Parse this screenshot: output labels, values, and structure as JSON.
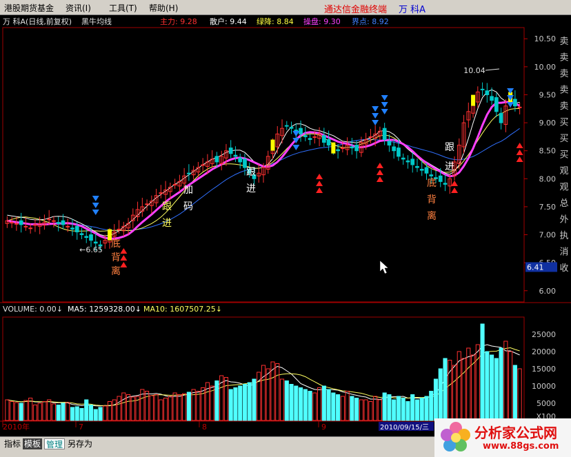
{
  "menu": {
    "items": [
      "港股期货基金",
      "资讯(I)",
      "工具(T)",
      "帮助(H)"
    ],
    "app_title": "通达信金融终端",
    "stock_title": "万  科A"
  },
  "indicator_header": {
    "stock": "万  科A(日线,前复权)",
    "formula": "黑牛均线",
    "items": [
      {
        "label": "主力: 9.28",
        "color": "#ff3030"
      },
      {
        "label": "散户: 9.44",
        "color": "#ffffff"
      },
      {
        "label": "绿降: 8.84",
        "color": "#ffff40"
      },
      {
        "label": "操盘: 9.30",
        "color": "#ff40ff"
      },
      {
        "label": "界点: 8.92",
        "color": "#4080ff"
      }
    ]
  },
  "price_axis": {
    "labels": [
      "10.50",
      "10.00",
      "9.50",
      "9.00",
      "8.50",
      "8.00",
      "7.50",
      "7.00",
      "6.50",
      "6.00"
    ],
    "current_label": "6.41"
  },
  "volume_header": {
    "vol": "VOLUME: 0.00",
    "ma5": "MA5: 1259328.00",
    "ma10": "MA10: 1607507.25"
  },
  "volume_axis": {
    "labels": [
      "25000",
      "20000",
      "15000",
      "10000",
      "5000",
      "X100"
    ]
  },
  "date_axis": {
    "labels": [
      "2010年",
      "7",
      "8",
      "9"
    ],
    "cursor_date": "2010/09/15/三"
  },
  "side_signals": [
    "卖",
    "卖",
    "卖",
    "卖",
    "卖",
    "买",
    "买",
    "买",
    "观",
    "观",
    "总",
    "外",
    "执",
    "消",
    "收"
  ],
  "annotations": {
    "high_label": "10.04",
    "low_label": "6.65",
    "texts": [
      {
        "text": "底",
        "color": "#ff8040"
      },
      {
        "text": "背",
        "color": "#ff8040"
      },
      {
        "text": "离",
        "color": "#ff8040"
      },
      {
        "text": "跟",
        "color": "#ffff60"
      },
      {
        "text": "进",
        "color": "#ffff60"
      },
      {
        "text": "加",
        "color": "#ffffff"
      },
      {
        "text": "码",
        "color": "#ffffff"
      },
      {
        "text": "跟",
        "color": "#ffffff"
      },
      {
        "text": "进",
        "color": "#ffffff"
      },
      {
        "text": "底",
        "color": "#ff8040"
      },
      {
        "text": "背",
        "color": "#ff8040"
      },
      {
        "text": "离",
        "color": "#ff8040"
      },
      {
        "text": "跟",
        "color": "#ffffff"
      },
      {
        "text": "进",
        "color": "#ffffff"
      }
    ]
  },
  "tabs": [
    "指标",
    "模板",
    "管理",
    "另存为"
  ],
  "watermark": {
    "title": "分析家公式网",
    "url": "www.88gs.com"
  },
  "chart_data": {
    "type": "candlestick",
    "ylim": [
      5.8,
      10.7
    ],
    "close": [
      7.25,
      7.22,
      7.2,
      7.18,
      7.15,
      7.12,
      7.18,
      7.2,
      7.22,
      7.28,
      7.25,
      7.2,
      7.18,
      7.15,
      7.1,
      7.05,
      7.0,
      6.95,
      6.9,
      6.85,
      6.8,
      6.9,
      7.0,
      7.05,
      7.1,
      7.15,
      7.2,
      7.35,
      7.45,
      7.5,
      7.55,
      7.6,
      7.7,
      7.75,
      7.8,
      7.85,
      7.9,
      7.95,
      8.05,
      8.1,
      8.15,
      8.2,
      8.25,
      8.3,
      8.35,
      8.3,
      8.4,
      8.5,
      8.45,
      8.4,
      8.3,
      8.2,
      8.1,
      8.0,
      8.1,
      8.2,
      8.4,
      8.6,
      8.8,
      8.9,
      8.95,
      8.9,
      8.85,
      8.8,
      8.75,
      8.7,
      8.75,
      8.8,
      8.65,
      8.6,
      8.55,
      8.5,
      8.55,
      8.6,
      8.55,
      8.5,
      8.65,
      8.7,
      8.75,
      8.8,
      8.85,
      8.7,
      8.6,
      8.5,
      8.4,
      8.35,
      8.3,
      8.25,
      8.2,
      8.15,
      8.1,
      8.05,
      8.0,
      7.95,
      7.9,
      8.0,
      8.3,
      8.6,
      9.0,
      9.2,
      9.4,
      9.55,
      9.6,
      9.5,
      9.4,
      9.2,
      9.0,
      9.3,
      9.45,
      9.3,
      9.28
    ],
    "volume": [
      6000,
      5500,
      5200,
      5000,
      5800,
      6500,
      4500,
      5000,
      5500,
      6000,
      4800,
      4500,
      5000,
      5200,
      3800,
      4000,
      3500,
      6000,
      4500,
      3200,
      3800,
      4200,
      5500,
      6000,
      7000,
      8000,
      7500,
      6800,
      7000,
      9000,
      8500,
      7200,
      7500,
      6000,
      6500,
      7000,
      8000,
      7500,
      7800,
      8200,
      9000,
      8500,
      9500,
      11000,
      10000,
      11500,
      13000,
      12500,
      9000,
      9500,
      10000,
      10500,
      11000,
      12000,
      14000,
      16000,
      15000,
      17000,
      16500,
      12000,
      11500,
      10500,
      10000,
      9500,
      9000,
      8500,
      8000,
      9500,
      10000,
      9000,
      8000,
      7500,
      7000,
      8500,
      7000,
      6500,
      6000,
      6000,
      5500,
      7000,
      6000,
      8000,
      7500,
      6000,
      7000,
      6500,
      5500,
      7500,
      6000,
      6500,
      7000,
      8500,
      12000,
      15000,
      18000,
      17500,
      16000,
      20000,
      18000,
      21000,
      19000,
      22000,
      28000,
      20000,
      19000,
      18000,
      21000,
      23000,
      20000,
      16000,
      15000
    ]
  }
}
